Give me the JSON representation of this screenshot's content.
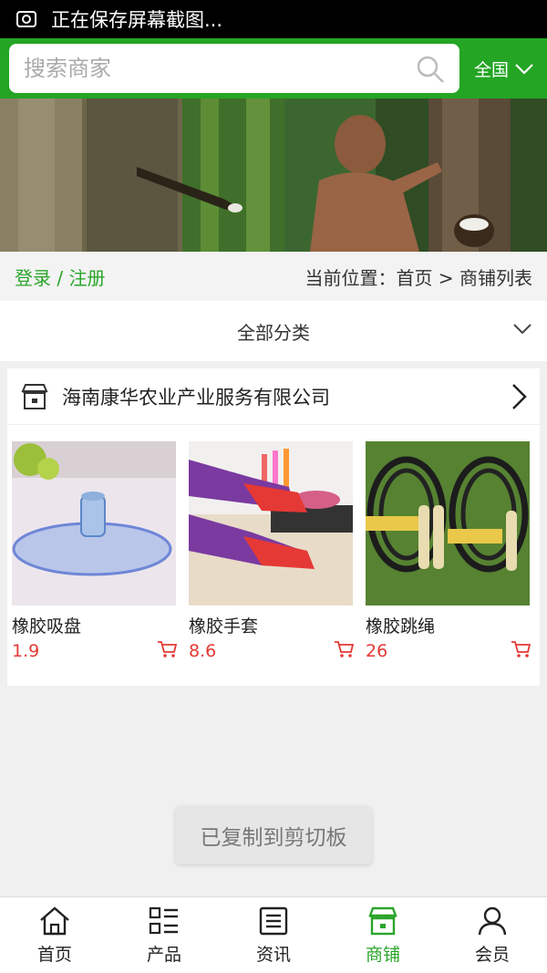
{
  "status_bar": {
    "notification": "正在保存屏幕截图..."
  },
  "header": {
    "search_placeholder": "搜索商家",
    "region": "全国"
  },
  "breadcrumb_bar": {
    "login": "登录 / 注册",
    "location": "当前位置：首页 > 商铺列表"
  },
  "category": {
    "label": "全部分类"
  },
  "shop": {
    "name": "海南康华农业产业服务有限公司",
    "products": [
      {
        "name": "橡胶吸盘",
        "price": "1.9"
      },
      {
        "name": "橡胶手套",
        "price": "8.6"
      },
      {
        "name": "橡胶跳绳",
        "price": "26"
      }
    ]
  },
  "toast": "已复制到剪切板",
  "tabbar": {
    "items": [
      {
        "label": "首页",
        "icon": "home-icon"
      },
      {
        "label": "产品",
        "icon": "list-icon"
      },
      {
        "label": "资讯",
        "icon": "news-icon"
      },
      {
        "label": "商铺",
        "icon": "store-icon",
        "active": true
      },
      {
        "label": "会员",
        "icon": "user-icon"
      }
    ]
  },
  "colors": {
    "brand_green": "#24a524",
    "price_red": "#e53935"
  }
}
